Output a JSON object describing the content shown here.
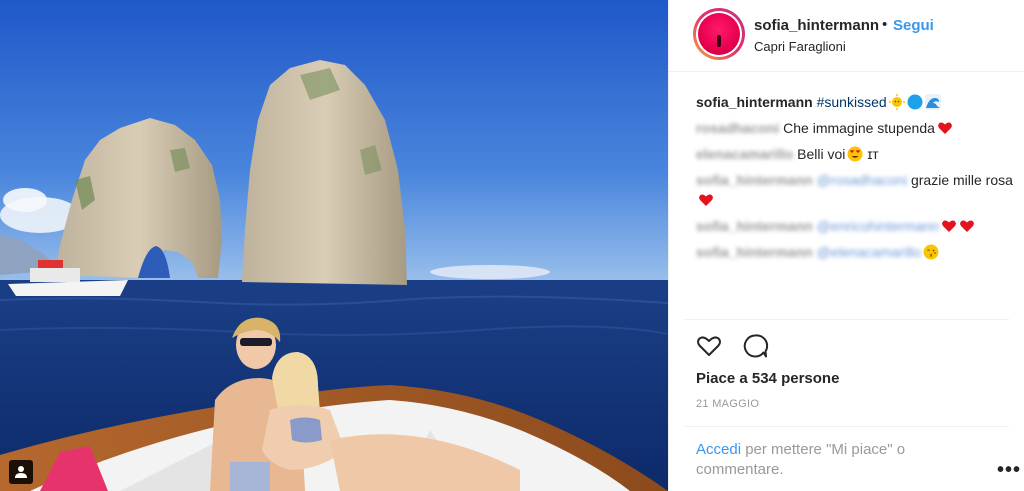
{
  "post": {
    "username": "sofia_hintermann",
    "separator": "•",
    "follow_label": "Segui",
    "location": "Capri Faraglioni"
  },
  "caption": {
    "username": "sofia_hintermann",
    "hashtag": "#sunkissed",
    "emojis": [
      "sun-face-icon",
      "blue-circle-icon",
      "wave-icon"
    ]
  },
  "comments": [
    {
      "user": "rosadhaconi",
      "text": "Che immagine stupenda",
      "emoji": "red-heart-icon"
    },
    {
      "user": "elenacamarillo",
      "text": "Belli voi",
      "emoji": "heart-eyes-icon",
      "suffix": "ɪᴛ"
    },
    {
      "user": "sofia_hintermann",
      "mention": "@rosadhaconi",
      "text": "grazie mille rosa",
      "emoji": "red-heart-icon"
    },
    {
      "user": "sofia_hintermann",
      "mention": "@enricohintermann",
      "emoji": "red-heart-icon"
    },
    {
      "user": "sofia_hintermann",
      "mention": "@elenacamarillo",
      "emoji": "kiss-face-icon"
    }
  ],
  "likes_text": "Piace a 534 persone",
  "date_text": "21 MAGGIO",
  "login": {
    "link": "Accedi",
    "rest": "per mettere \"Mi piace\" o commentare."
  },
  "more_label": "•••",
  "colors": {
    "link_blue": "#3897f0",
    "hashtag_blue": "#003569",
    "heart_red": "#ed2d3a"
  }
}
